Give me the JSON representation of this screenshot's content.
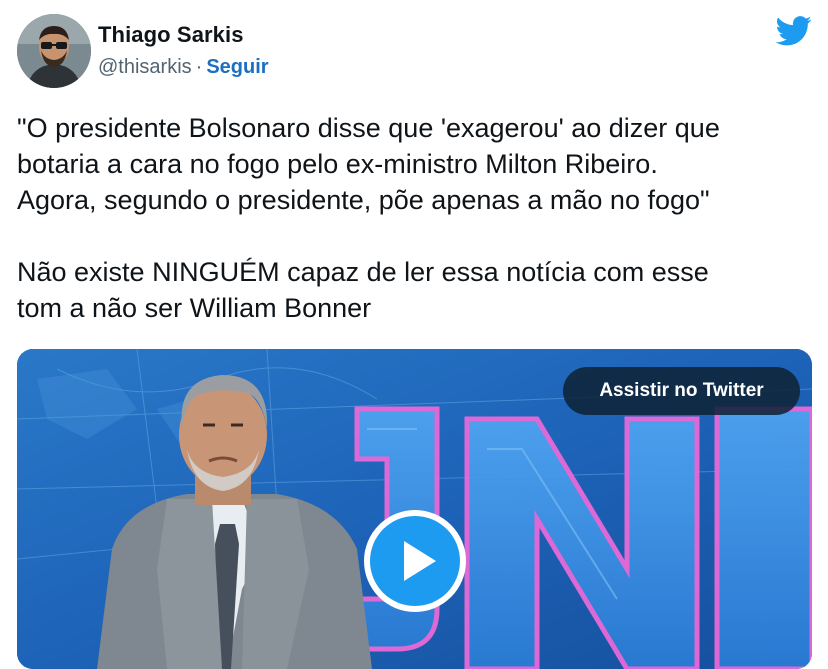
{
  "author": {
    "name": "Thiago Sarkis",
    "handle": "@thisarkis",
    "separator": "·",
    "follow_label": "Seguir"
  },
  "tweet": {
    "paragraph1": [
      "\"O presidente Bolsonaro disse que 'exagerou' ao dizer que",
      "botaria a cara no fogo pelo ex-ministro Milton Ribeiro.",
      "Agora, segundo o presidente, põe apenas a mão no fogo\""
    ],
    "paragraph2": [
      "Não existe NINGUÉM capaz de ler essa notícia com esse",
      "tom a não ser William Bonner"
    ]
  },
  "media": {
    "watch_label": "Assistir no Twitter",
    "play_icon": "play-icon"
  },
  "colors": {
    "twitter_blue": "#1d9bf0",
    "follow_link": "#1d6fc0",
    "text_primary": "#0f1419",
    "text_secondary": "#536471"
  },
  "icons": {
    "brand": "twitter-bird-icon"
  }
}
